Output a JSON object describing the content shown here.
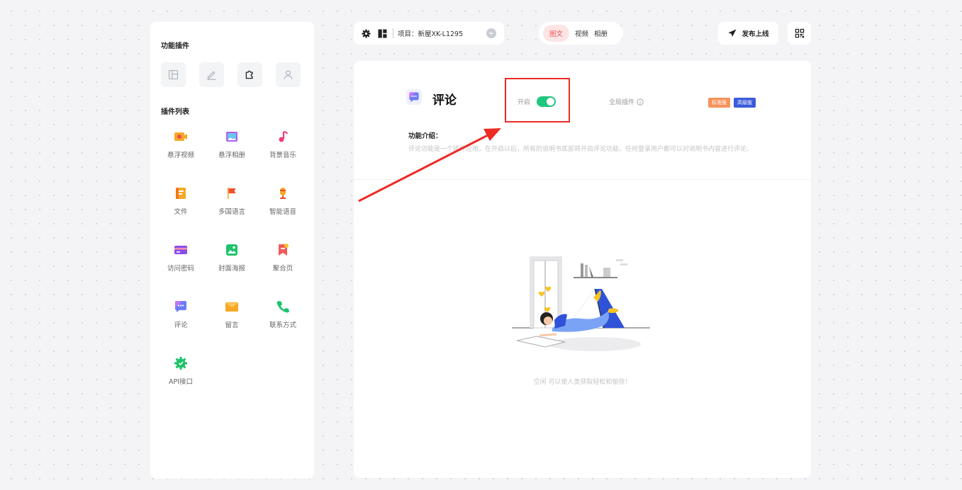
{
  "sidebar": {
    "tools_title": "功能插件",
    "tools": [
      {
        "icon": "layout-icon",
        "active": false
      },
      {
        "icon": "edit-icon",
        "active": false
      },
      {
        "icon": "puzzle-icon",
        "active": true
      },
      {
        "icon": "user-icon",
        "active": false
      }
    ],
    "list_title": "插件列表",
    "plugins": [
      {
        "label": "悬浮视频",
        "icon": "video-icon"
      },
      {
        "label": "悬浮相册",
        "icon": "album-icon"
      },
      {
        "label": "背景音乐",
        "icon": "music-icon"
      },
      {
        "label": "文件",
        "icon": "file-icon"
      },
      {
        "label": "多国语言",
        "icon": "flag-icon"
      },
      {
        "label": "智能语音",
        "icon": "microphone-icon"
      },
      {
        "label": "访问密码",
        "icon": "card-icon"
      },
      {
        "label": "封面海报",
        "icon": "poster-icon"
      },
      {
        "label": "聚合页",
        "icon": "bookmark-icon"
      },
      {
        "label": "评论",
        "icon": "comment-icon"
      },
      {
        "label": "留言",
        "icon": "mail-icon"
      },
      {
        "label": "联系方式",
        "icon": "phone-icon"
      },
      {
        "label": "API接口",
        "icon": "api-gear-icon"
      }
    ]
  },
  "topbar": {
    "project_label": "项目：新屋XK-L1295",
    "modes": [
      "图文",
      "视频",
      "相册"
    ],
    "active_mode": "图文",
    "publish_label": "发布上线"
  },
  "main": {
    "title": "评论",
    "toggle_label": "开启",
    "toggle_on": true,
    "global_label": "全局插件",
    "badges": [
      {
        "text": "标准版",
        "color": "#f5935b"
      },
      {
        "text": "高级版",
        "color": "#3b5bdb"
      }
    ],
    "intro_title": "功能介绍：",
    "intro_text": "评论功能是一个插件应用，在开启以后，所有的说明书底部将开启评论功能，任何登录用户都可以对说明书内容进行评论。",
    "empty_text": "空闲  可以使人类获取轻松和愉快！"
  },
  "colors": {
    "accent_red": "#e8524f",
    "toggle_green": "#1fc77e",
    "highlight_box": "#ee2a24"
  }
}
